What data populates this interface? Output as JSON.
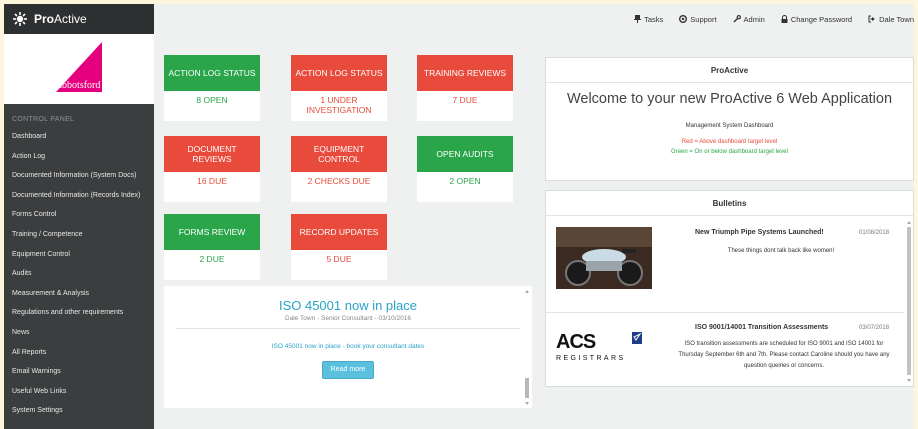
{
  "app": {
    "brand_bold": "Pro",
    "brand_rest": "Active"
  },
  "sidebar": {
    "section_title": "CONTROL PANEL",
    "logo_text": "abbotsford",
    "items": [
      {
        "label": "Dashboard"
      },
      {
        "label": "Action Log"
      },
      {
        "label": "Documented Information (System Docs)"
      },
      {
        "label": "Documented Information (Records Index)"
      },
      {
        "label": "Forms Control"
      },
      {
        "label": "Training / Competence"
      },
      {
        "label": "Equipment Control"
      },
      {
        "label": "Audits"
      },
      {
        "label": "Measurement & Analysis"
      },
      {
        "label": "Regulations and other requirements"
      },
      {
        "label": "News"
      },
      {
        "label": "All Reports"
      },
      {
        "label": "Email Warnings"
      },
      {
        "label": "Useful Web Links"
      },
      {
        "label": "System Settings"
      }
    ]
  },
  "topbar": {
    "tasks": "Tasks",
    "support": "Support",
    "admin": "Admin",
    "change_password": "Change Password",
    "user": "Dale Town"
  },
  "tiles": [
    {
      "title": "ACTION LOG STATUS",
      "value": "8 OPEN",
      "status": "green"
    },
    {
      "title": "ACTION LOG STATUS",
      "value": "1 UNDER INVESTIGATION",
      "status": "red"
    },
    {
      "title": "TRAINING REVIEWS",
      "value": "7 DUE",
      "status": "red"
    },
    {
      "title": "DOCUMENT REVIEWS",
      "value": "16 DUE",
      "status": "red"
    },
    {
      "title": "EQUIPMENT CONTROL",
      "value": "2 CHECKS DUE",
      "status": "red"
    },
    {
      "title": "OPEN AUDITS",
      "value": "2 OPEN",
      "status": "green"
    },
    {
      "title": "FORMS REVIEW",
      "value": "2 DUE",
      "status": "green"
    },
    {
      "title": "RECORD UPDATES",
      "value": "5 DUE",
      "status": "red"
    }
  ],
  "news": {
    "title": "ISO 45001 now in place",
    "byline": "Dale Town - Senior Consultant - 03/10/2016",
    "body": "ISO 45001 now in place - book your consultant dates",
    "read_more": "Read more"
  },
  "welcome_panel": {
    "header": "ProActive",
    "welcome": "Welcome to your new ProActive 6 Web Application",
    "subtitle": "Management System Dashboard",
    "red_note": "Red = Above dashboard target level",
    "green_note": "Green = On or below dashboard target level"
  },
  "bulletins": {
    "header": "Bulletins",
    "items": [
      {
        "title": "New Triumph Pipe Systems Launched!",
        "date": "01/08/2018",
        "text": "These things dont talk back like women!"
      },
      {
        "title": "ISO 9001/14001 Transition Assessments",
        "date": "03/07/2018",
        "text": "ISO transition assessments are scheduled for ISO 9001 and ISO 14001 for Thursday September 6th and 7th. Please contact Caroline should you have any question queiries or concerns.",
        "logo_text": "REGISTRARS"
      }
    ]
  },
  "colors": {
    "green": "#2aa54a",
    "red": "#e84b3c",
    "sidebar": "#3b3d3e",
    "accent": "#29a3c9"
  }
}
